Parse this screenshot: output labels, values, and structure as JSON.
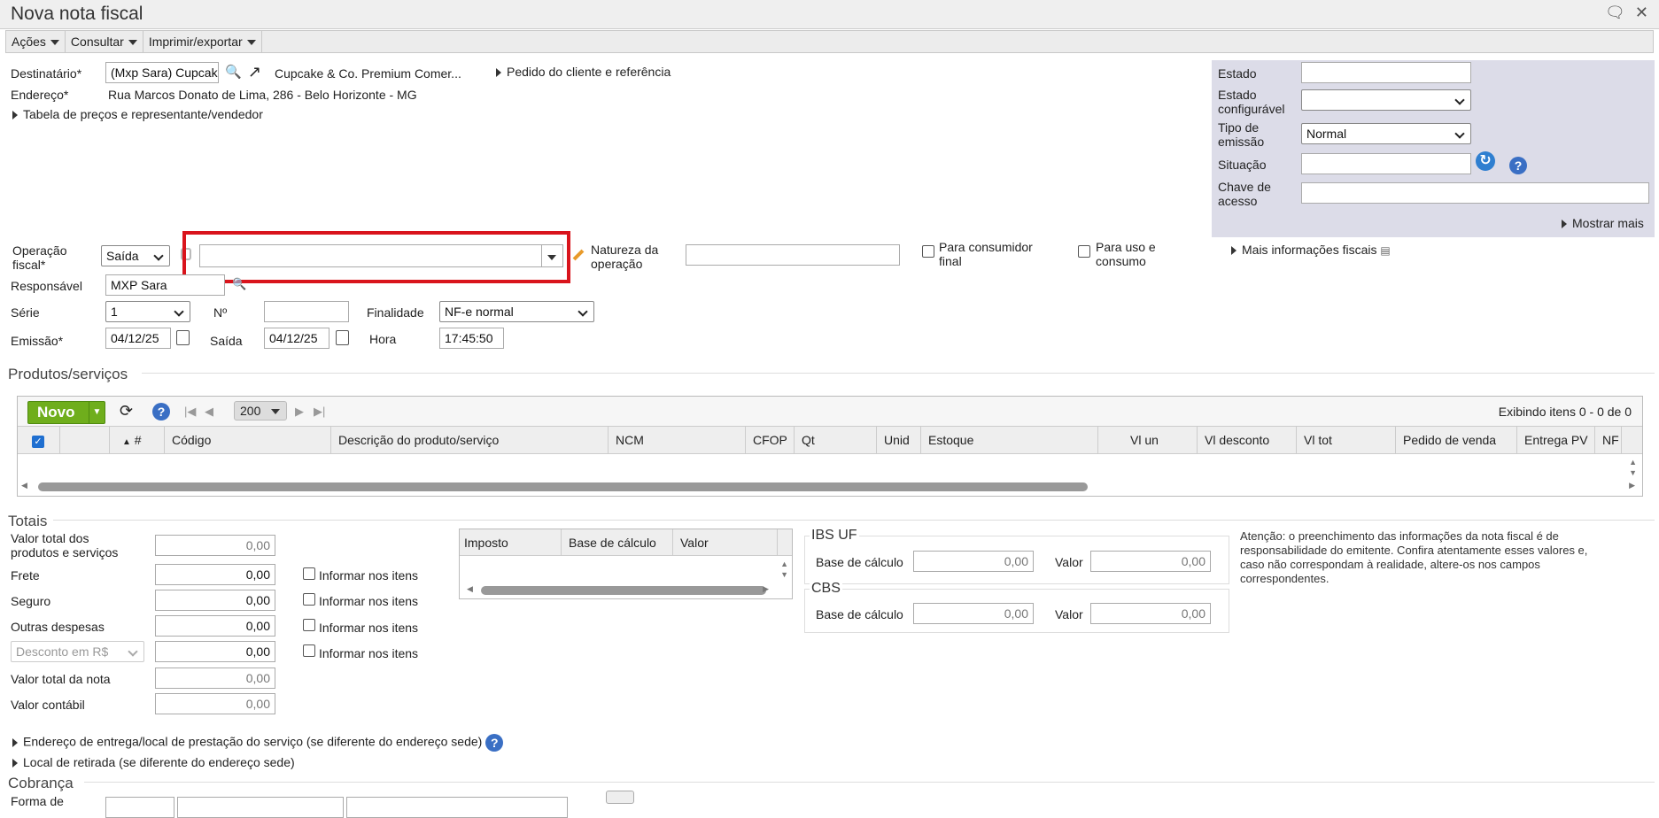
{
  "window": {
    "title": "Nova nota fiscal",
    "icons": [
      "comment-icon",
      "close-icon"
    ]
  },
  "menu": [
    "Ações",
    "Consultar",
    "Imprimir/exportar"
  ],
  "header": {
    "destinatario_label": "Destinatário*",
    "destinatario_value": "(Mxp Sara) Cupcak",
    "destinatario_name": "Cupcake & Co. Premium Comer...",
    "pedido_link": "Pedido do cliente e referência",
    "endereco_label": "Endereço*",
    "endereco_value": "Rua Marcos Donato de Lima, 286 - Belo Horizonte - MG",
    "tabela_link": "Tabela de preços e representante/vendedor"
  },
  "side": {
    "estado": "Estado",
    "estado_configuravel": [
      "Estado",
      "configurável"
    ],
    "tipo_emissao": [
      "Tipo de",
      "emissão"
    ],
    "tipo_emissao_value": "Normal",
    "situacao": "Situação",
    "chave": [
      "Chave de",
      "acesso"
    ],
    "mostrar_mais": "Mostrar mais"
  },
  "operacao": {
    "label": [
      "Operação",
      "fiscal*"
    ],
    "value": "Saída",
    "natureza_label": [
      "Natureza da",
      "operação"
    ],
    "consumidor_final": [
      "Para consumidor",
      "final"
    ],
    "uso_consumo": [
      "Para uso e",
      "consumo"
    ],
    "mais_info": "Mais informações fiscais",
    "responsavel_label": "Responsável",
    "responsavel_value": "MXP Sara",
    "serie_label": "Série",
    "serie_value": "1",
    "numero_label": "Nº",
    "finalidade_label": "Finalidade",
    "finalidade_value": "NF-e normal",
    "emissao_label": "Emissão*",
    "emissao_value": "04/12/25",
    "saida_label": "Saída",
    "saida_value": "04/12/25",
    "hora_label": "Hora",
    "hora_value": "17:45:50"
  },
  "produtos": {
    "title": "Produtos/serviços",
    "novo": "Novo",
    "page_size": "200",
    "exibindo": "Exibindo itens 0 - 0 de 0",
    "columns": [
      "#",
      "Código",
      "Descrição do produto/serviço",
      "NCM",
      "CFOP",
      "Qt",
      "Unid",
      "Estoque",
      "Vl un",
      "Vl desconto",
      "Vl tot",
      "Pedido de venda",
      "Entrega PV",
      "NF"
    ]
  },
  "totais": {
    "title": "Totais",
    "valor_total_produtos": [
      "Valor total dos",
      "produtos e serviços"
    ],
    "valor_total_produtos_value": "0,00",
    "frete": "Frete",
    "frete_value": "0,00",
    "seguro": "Seguro",
    "seguro_value": "0,00",
    "outras": "Outras despesas",
    "outras_value": "0,00",
    "desconto_select": "Desconto em R$",
    "desconto_value": "0,00",
    "valor_total_nota": "Valor total da nota",
    "valor_total_nota_value": "0,00",
    "valor_contabil": "Valor contábil",
    "valor_contabil_value": "0,00",
    "informar": "Informar nos itens",
    "imposto_cols": [
      "Imposto",
      "Base de cálculo",
      "Valor"
    ],
    "ibs_title": "IBS UF",
    "cbs_title": "CBS",
    "base_calculo": "Base de cálculo",
    "valor": "Valor",
    "zero": "0,00",
    "atencao": "Atenção: o preenchimento das informações da nota fiscal é de responsabilidade do emitente. Confira atentamente esses valores e, caso não correspondam à realidade, altere-os nos campos correspondentes."
  },
  "footer": {
    "entrega": "Endereço de entrega/local de prestação do serviço (se diferente do endereço sede)",
    "retirada": "Local de retirada (se diferente do endereço sede)",
    "cobranca": "Cobrança",
    "forma": "Forma de"
  },
  "colors": {
    "highlight": "#d9141c",
    "green": "#6fae1c",
    "panel": "#dcdce8",
    "help": "#3a6fc4"
  }
}
